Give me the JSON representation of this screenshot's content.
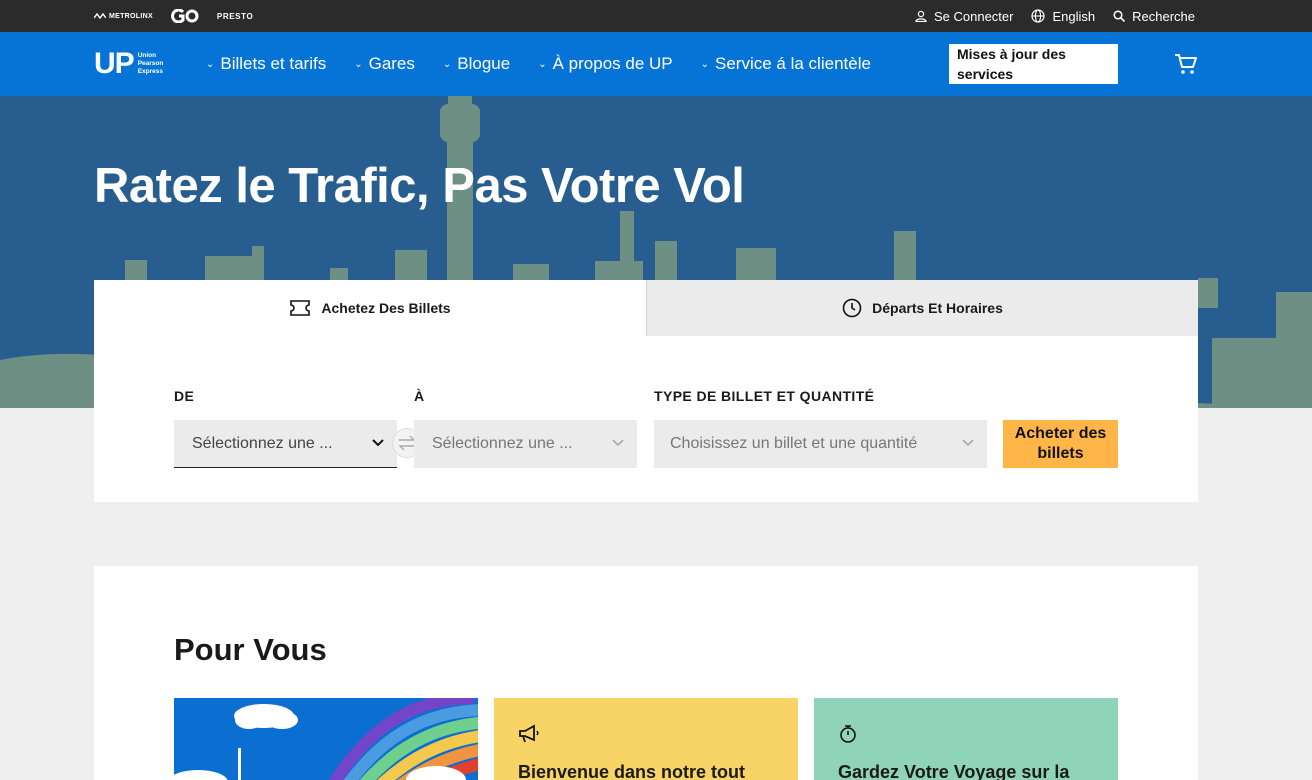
{
  "utility_bar": {
    "logos": [
      "METROLINX",
      "GO",
      "PRESTO"
    ],
    "sign_in": "Se Connecter",
    "language": "English",
    "search": "Recherche"
  },
  "nav": {
    "logo_letters": "UP",
    "logo_sub": [
      "Union",
      "Pearson",
      "Express"
    ],
    "items": [
      {
        "label": "Billets et tarifs"
      },
      {
        "label": "Gares"
      },
      {
        "label": "Blogue"
      },
      {
        "label": "À propos de UP"
      },
      {
        "label": "Service á la clientèle"
      }
    ],
    "service_updates": "Mises à jour des services"
  },
  "hero": {
    "title": "Ratez le Trafic, Pas Votre Vol"
  },
  "booking": {
    "tabs": [
      {
        "label": "Achetez Des Billets",
        "icon": "ticket-icon",
        "selected": true
      },
      {
        "label": "Départs Et Horaires",
        "icon": "clock-icon",
        "selected": false
      }
    ],
    "from_label": "DE",
    "from_placeholder": "Sélectionnez une ...",
    "to_label": "À",
    "to_placeholder": "Sélectionnez une ...",
    "ticket_label": "TYPE DE BILLET ET QUANTITÉ",
    "ticket_placeholder": "Choisissez un billet et une quantité",
    "buy_button": "Acheter des billets"
  },
  "pour_vous": {
    "title": "Pour Vous",
    "cards": [
      {
        "type": "image",
        "icon": "rainbow-skyline-image"
      },
      {
        "text": "Bienvenue dans notre tout",
        "icon": "megaphone-icon"
      },
      {
        "text": "Gardez Votre Voyage sur la",
        "icon": "stopwatch-icon"
      }
    ]
  },
  "colors": {
    "nav_blue": "#0574d6",
    "hero_blue": "#275e8f",
    "skyline": "#6e8f83",
    "buy_orange": "#ffb547",
    "card_yellow": "#f8d466",
    "card_green": "#8fd4b8"
  }
}
